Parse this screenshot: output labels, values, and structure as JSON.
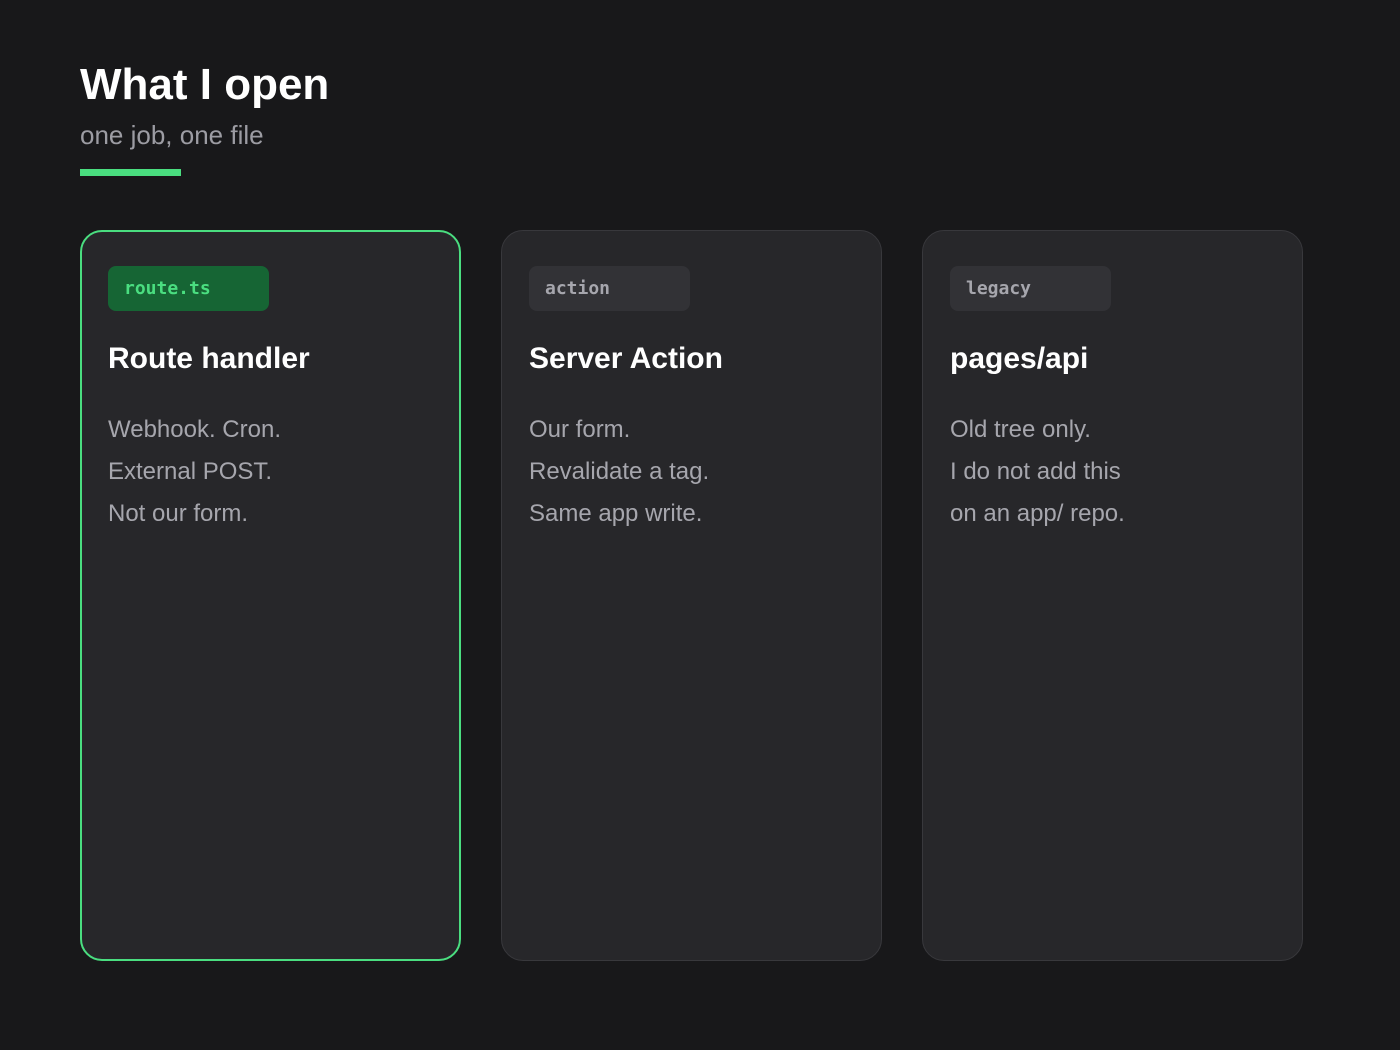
{
  "header": {
    "title": "What I open",
    "subtitle": "one job, one file",
    "accent_color": "#4ade80"
  },
  "cards": [
    {
      "tag": "route.ts",
      "title": "Route handler",
      "lines": [
        "Webhook. Cron.",
        "External POST.",
        "Not our form."
      ],
      "active": true
    },
    {
      "tag": "action",
      "title": "Server Action",
      "lines": [
        "Our form.",
        "Revalidate a tag.",
        "Same app write."
      ],
      "active": false
    },
    {
      "tag": "legacy",
      "title": "pages/api",
      "lines": [
        "Old tree only.",
        "I do not add this",
        "on an app/ repo."
      ],
      "active": false
    }
  ]
}
